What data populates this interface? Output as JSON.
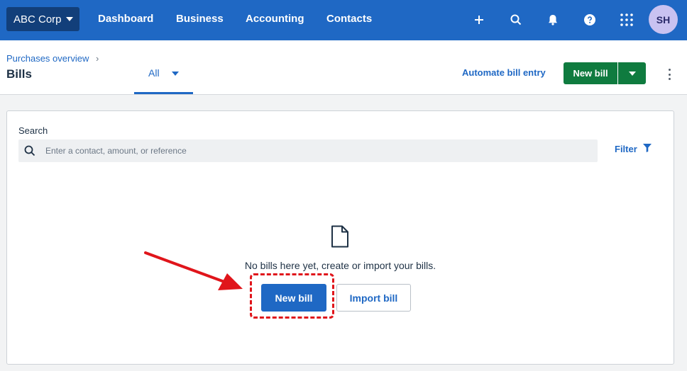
{
  "topnav": {
    "org_name": "ABC Corp",
    "links": [
      "Dashboard",
      "Business",
      "Accounting",
      "Contacts"
    ],
    "icons": [
      "plus-icon",
      "search-icon",
      "bell-icon",
      "help-icon",
      "apps-grid-icon"
    ],
    "avatar_initials": "SH"
  },
  "subheader": {
    "breadcrumb": "Purchases overview",
    "breadcrumb_sep": "›",
    "title": "Bills",
    "tab_label": "All",
    "automate_label": "Automate bill entry",
    "new_bill_label": "New bill"
  },
  "search": {
    "label": "Search",
    "placeholder": "Enter a contact, amount, or reference",
    "filter_label": "Filter"
  },
  "empty_state": {
    "message": "No bills here yet, create or import your bills.",
    "new_bill_label": "New bill",
    "import_bill_label": "Import bill"
  },
  "colors": {
    "nav_blue": "#1f68c4",
    "org_dark": "#123f7a",
    "green": "#0f7b3f",
    "annotation_red": "#e0151b"
  }
}
